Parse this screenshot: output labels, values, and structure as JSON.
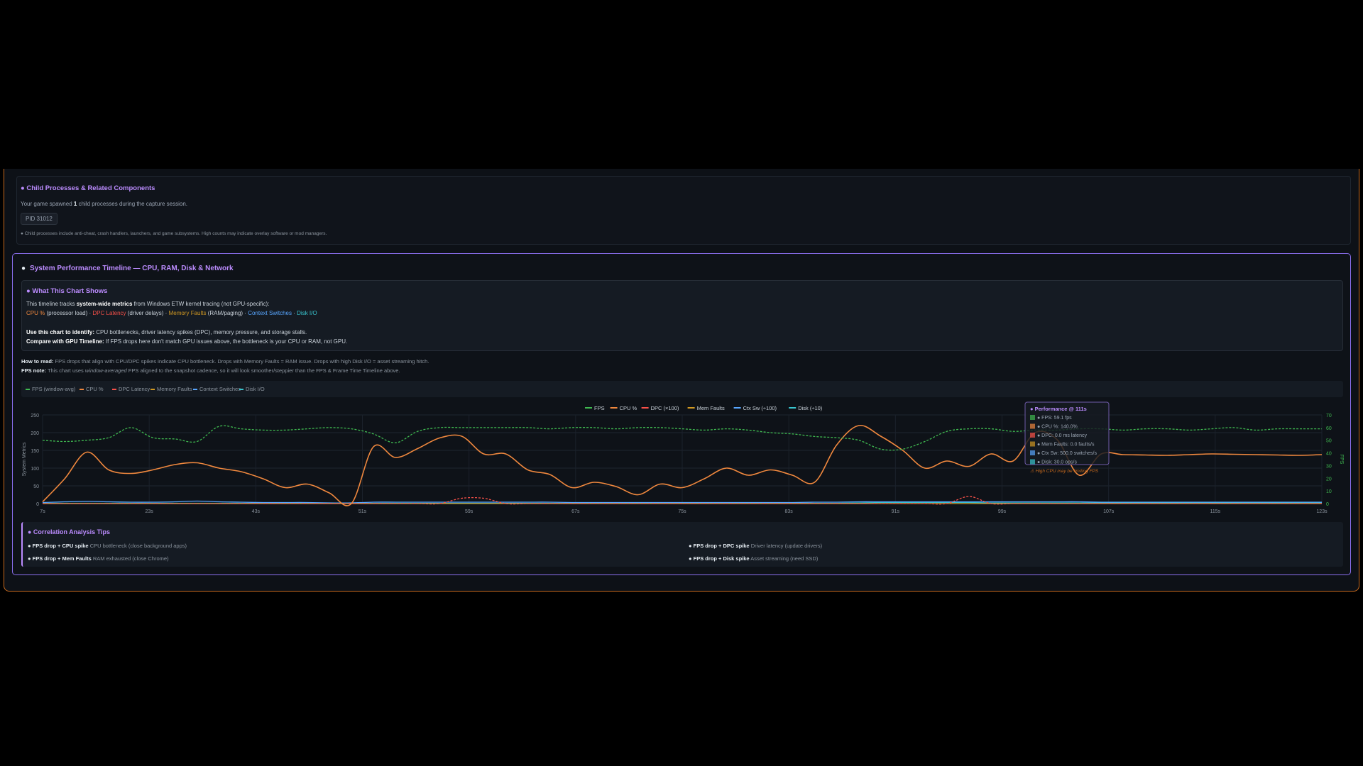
{
  "child": {
    "title": "● Child Processes & Related Components",
    "desc_pre": "Your game spawned",
    "desc_count": "1",
    "desc_post": "child processes during the capture session.",
    "pid": "PID 31012",
    "note": "● Child processes include anti-cheat, crash handlers, launchers, and game subsystems. High counts may indicate overlay software or mod managers."
  },
  "perf": {
    "title": "System Performance Timeline — CPU, RAM, Disk & Network",
    "what_title": "● What This Chart Shows",
    "line1_pre": "This timeline tracks",
    "line1_bold": "system-wide metrics",
    "line1_post": "from Windows ETW kernel tracing (not GPU-specific):",
    "m_cpu": "CPU %",
    "m_cpu_desc": "(processor load) ·",
    "m_dpc": "DPC Latency",
    "m_dpc_desc": "(driver delays) ·",
    "m_mem": "Memory Faults",
    "m_mem_desc": "(RAM/paging) ·",
    "m_ctx": "Context Switches",
    "m_sep": "·",
    "m_disk": "Disk I/O",
    "use_bold": "Use this chart to identify:",
    "use_text": "CPU bottlenecks, driver latency spikes (DPC), memory pressure, and storage stalls.",
    "compare_bold": "Compare with GPU Timeline:",
    "compare_text": "If FPS drops here don't match GPU issues above, the bottleneck is your CPU or RAM, not GPU.",
    "howto_bold": "How to read:",
    "howto_text": "FPS drops that align with CPU/DPC spikes indicate CPU bottleneck. Drops with Memory Faults = RAM issue. Drops with high Disk I/O = asset streaming hitch.",
    "fpsnote_bold": "FPS note:",
    "fpsnote_pre": "This chart uses",
    "fpsnote_em": "window-averaged",
    "fpsnote_post": "FPS aligned to the snapshot cadence, so it will look smoother/steppier than the FPS & Frame Time Timeline above."
  },
  "toggle_legend": [
    {
      "label": "FPS (window-avg)",
      "color": "#3fb950"
    },
    {
      "label": "CPU %",
      "color": "#f0883e"
    },
    {
      "label": "DPC Latency",
      "color": "#f85149"
    },
    {
      "label": "Memory Faults",
      "color": "#d29922"
    },
    {
      "label": "Context Switches",
      "color": "#58a6ff"
    },
    {
      "label": "Disk I/O",
      "color": "#39c5cf"
    }
  ],
  "chart_data": {
    "type": "line",
    "legend": [
      {
        "label": "FPS",
        "color": "#3fb950"
      },
      {
        "label": "CPU %",
        "color": "#f0883e"
      },
      {
        "label": "DPC (×100)",
        "color": "#f85149"
      },
      {
        "label": "Mem Faults",
        "color": "#d29922"
      },
      {
        "label": "Ctx Sw (÷100)",
        "color": "#58a6ff"
      },
      {
        "label": "Disk (÷10)",
        "color": "#39c5cf"
      }
    ],
    "ylabel_left": "System Metrics",
    "ylabel_right": "FPS",
    "ylim_left": [
      0,
      250
    ],
    "ylim_right": [
      0,
      70
    ],
    "yticks_left": [
      "0",
      "50",
      "100",
      "150",
      "200",
      "250"
    ],
    "yticks_right": [
      "0",
      "10",
      "20",
      "30",
      "40",
      "50",
      "60",
      "70"
    ],
    "xlim": [
      7,
      123
    ],
    "xticks": [
      "7s",
      "23s",
      "43s",
      "51s",
      "59s",
      "67s",
      "75s",
      "83s",
      "91s",
      "99s",
      "107s",
      "115s",
      "123s"
    ],
    "x": [
      7,
      9,
      11,
      13,
      15,
      17,
      19,
      21,
      23,
      25,
      27,
      29,
      31,
      33,
      35,
      37,
      39,
      41,
      43,
      45,
      47,
      49,
      51,
      53,
      55,
      57,
      59,
      61,
      63,
      65,
      67,
      69,
      71,
      73,
      75,
      77,
      79,
      81,
      83,
      85,
      87,
      89,
      91,
      93,
      95,
      97,
      99,
      101,
      103,
      105,
      107,
      109,
      111,
      113,
      115,
      117,
      119,
      121,
      123
    ],
    "series": [
      {
        "name": "FPS",
        "color": "#3fb950",
        "dashed": true,
        "axis": "right",
        "values": [
          50,
          49,
          50,
          52,
          60,
          52,
          51,
          49,
          61,
          59,
          58,
          58,
          59,
          60,
          59,
          55,
          48,
          57,
          60,
          60,
          60,
          60,
          60,
          59,
          60,
          60,
          59,
          60,
          60,
          59,
          58,
          59,
          58,
          56,
          55,
          53,
          52,
          50,
          43,
          43,
          49,
          57,
          59,
          59,
          57,
          58,
          58,
          59,
          59,
          58,
          59,
          59,
          58,
          59,
          60,
          58,
          59,
          59,
          59
        ]
      },
      {
        "name": "CPU %",
        "color": "#f0883e",
        "dashed": false,
        "axis": "left",
        "values": [
          5,
          70,
          145,
          95,
          85,
          95,
          110,
          115,
          100,
          90,
          70,
          45,
          55,
          30,
          0,
          160,
          130,
          155,
          185,
          190,
          140,
          140,
          95,
          82,
          45,
          60,
          48,
          25,
          55,
          45,
          70,
          100,
          80,
          95,
          80,
          60,
          165,
          220,
          190,
          150,
          100,
          120,
          105,
          140,
          120,
          200,
          180,
          80,
          140,
          138,
          137,
          136,
          138,
          140,
          139,
          138,
          137,
          136,
          138
        ]
      },
      {
        "name": "DPC (×100)",
        "color": "#f85149",
        "dashed": true,
        "axis": "left",
        "values": [
          0,
          0,
          0,
          0,
          0,
          0,
          0,
          0,
          0,
          0,
          0,
          0,
          0,
          0,
          0,
          0,
          0,
          0,
          0,
          15,
          15,
          0,
          0,
          0,
          0,
          0,
          0,
          0,
          0,
          0,
          0,
          0,
          0,
          0,
          0,
          0,
          0,
          0,
          0,
          0,
          0,
          0,
          20,
          0,
          0,
          0,
          0,
          0,
          0,
          0,
          0,
          0,
          0,
          0,
          0,
          0,
          0,
          0,
          0
        ]
      },
      {
        "name": "Mem Faults",
        "color": "#d29922",
        "dashed": false,
        "axis": "left",
        "values": [
          0,
          0,
          0,
          0,
          0,
          0,
          0,
          0,
          0,
          0,
          0,
          0,
          0,
          0,
          0,
          0,
          0,
          0,
          0,
          0,
          0,
          0,
          0,
          0,
          0,
          0,
          0,
          0,
          0,
          0,
          0,
          0,
          0,
          0,
          0,
          0,
          0,
          0,
          0,
          0,
          0,
          0,
          0,
          0,
          0,
          0,
          0,
          0,
          0,
          0,
          0,
          0,
          0,
          0,
          0,
          0,
          0,
          0,
          0
        ]
      },
      {
        "name": "Ctx Sw (÷100)",
        "color": "#58a6ff",
        "dashed": false,
        "axis": "left",
        "values": [
          3,
          5,
          6,
          5,
          4,
          4,
          5,
          7,
          5,
          4,
          3,
          3,
          3,
          2,
          2,
          4,
          4,
          4,
          4,
          4,
          4,
          4,
          4,
          4,
          3,
          3,
          3,
          3,
          3,
          3,
          3,
          3,
          3,
          3,
          3,
          4,
          4,
          5,
          5,
          5,
          5,
          5,
          5,
          5,
          5,
          5,
          5,
          5,
          4,
          4,
          4,
          4,
          4,
          4,
          4,
          4,
          4,
          4,
          4
        ]
      },
      {
        "name": "Disk (÷10)",
        "color": "#39c5cf",
        "dashed": false,
        "axis": "left",
        "values": [
          1,
          1,
          1,
          1,
          1,
          1,
          1,
          1,
          1,
          1,
          1,
          1,
          1,
          1,
          1,
          1,
          1,
          1,
          1,
          1,
          1,
          1,
          1,
          1,
          1,
          1,
          1,
          1,
          1,
          1,
          1,
          1,
          1,
          1,
          1,
          1,
          1,
          2,
          3,
          3,
          3,
          3,
          3,
          2,
          2,
          2,
          2,
          2,
          2,
          2,
          2,
          2,
          2,
          2,
          2,
          2,
          2,
          2,
          2
        ]
      }
    ],
    "tooltip": {
      "title": "● Performance @ 111s",
      "lines": [
        {
          "text": "● FPS: 59.1 fps",
          "color": "#3fb950"
        },
        {
          "text": "● CPU %: 140.0%",
          "color": "#f0883e"
        },
        {
          "text": "● DPC: 0.0 ms latency",
          "color": "#f85149"
        },
        {
          "text": "● Mem Faults: 0.0 faults/s",
          "color": "#d29922"
        },
        {
          "text": "● Ctx Sw: 500.0 switches/s",
          "color": "#58a6ff"
        },
        {
          "text": "● Disk: 30.0 ops/s",
          "color": "#39c5cf"
        }
      ],
      "warning": "⚠ High CPU may be limiting FPS"
    }
  },
  "tips": {
    "title": "● Correlation Analysis Tips",
    "items": [
      {
        "bold": "● FPS drop + CPU spike",
        "text": "CPU bottleneck (close background apps)"
      },
      {
        "bold": "● FPS drop + DPC spike",
        "text": "Driver latency (update drivers)"
      },
      {
        "bold": "● FPS drop + Mem Faults",
        "text": "RAM exhausted (close Chrome)"
      },
      {
        "bold": "● FPS drop + Disk spike",
        "text": "Asset streaming (need SSD)"
      }
    ]
  }
}
